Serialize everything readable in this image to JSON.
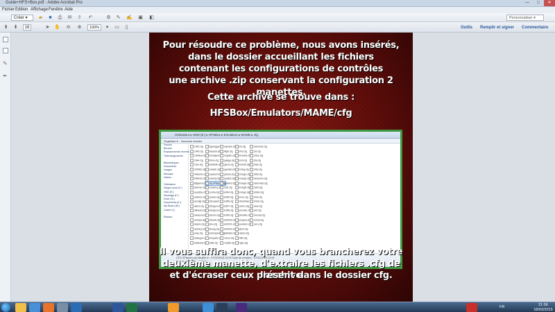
{
  "window": {
    "title": "Guide+HFS+Box.pdf - Adobe Acrobat Pro"
  },
  "menu": [
    "Fichier",
    "Edition",
    "Affichage",
    "Fenêtre",
    "Aide"
  ],
  "toolbar": {
    "create_label": "Créer",
    "personalize_label": "Personnaliser",
    "page_current": "16",
    "zoom": "100%",
    "links": [
      "Outils",
      "Remplir et signer",
      "Commentaire"
    ]
  },
  "document": {
    "paragraph1": [
      "Pour résoudre ce problème, nous avons insérés,",
      "dans le dossier accueillant les fichiers",
      "contenant les configurations de contrôles",
      "une archive .zip conservant la configuration 2 manettes."
    ],
    "paragraph2": "Cette archive se trouve dans :",
    "path": "HFSBox/Emulators/MAME/cfg",
    "paragraph3": [
      "Il vous suffira donc, quand vous brancherez votre",
      "deuxième manette, d'extraire les fichiers .cfg de l'archive",
      "et d'écraser ceux présent dans le dossier cfg."
    ]
  },
  "embedded_explorer": {
    "address": "Ordinateur ▸ HDD (E:) ▸ HFSBox ▸ Emulators ▸ MAME ▸ cfg",
    "nav": [
      "Favoris",
      "Bureau",
      "Emplacements récents",
      "Téléchargements",
      "",
      "Bibliothèques",
      "Documents",
      "Images",
      "Musique",
      "Vidéos",
      "",
      "Ordinateur",
      "Disque local (C:)",
      "HDD (E:)",
      "Stockage (F:)",
      "Drive (G:)",
      "Documents (K:)",
      "Mp Board (M:)",
      "Cache (I:)",
      "",
      "Réseau"
    ],
    "files": [
      "1942.cfg",
      "1943.cfg",
      "1943kai.cfg",
      "1944.cfg",
      "19xx.cfg",
      "2020bb.cfg",
      "4dwarrio.cfg",
      "64street.cfg",
      "88games.cfg",
      "aburner.cfg",
      "aceattac.cfg",
      "actfancr.cfg",
      "aerofgt.cfg",
      "aliens.cfg",
      "altbeast.cfg",
      "arkanoid.cfg",
      "armwar.cfg",
      "asterix.cfg",
      "atomicp.cfg",
      "avsp.cfg",
      "batsugun.cfg",
      "bbakraid.cfg",
      "bgaregga.cfg",
      "blazstar.cfg",
      "bombjack.cfg",
      "btime.cfg",
      "bublbobl.cfg",
      "cadash.cfg",
      "captcomm.cfg",
      "cawing.cfg",
      "cfg 2Players.zip",
      "chasehq.cfg",
      "contra.cfg",
      "cybots.cfg",
      "ddonpach.cfg",
      "ddragon.cfg",
      "ddragon2.cfg",
      "ddsom.cfg",
      "default.cfg",
      "dino.cfg",
      "dkong.cfg",
      "dodonpachi.cfg",
      "donpachi.cfg",
      "dstlk.cfg",
      "esprade.cfg",
      "ffight.cfg",
      "forgottn.cfg",
      "galaga.cfg",
      "garou.cfg",
      "gauntlet.cfg",
      "ghouls.cfg",
      "gradius.cfg",
      "gunbird.cfg",
      "hsf2.cfg",
      "kof94.cfg",
      "kof95.cfg",
      "kof96.cfg",
      "kof97.cfg",
      "kof98.cfg",
      "kof99.cfg",
      "kof2000.cfg",
      "kof2001.cfg",
      "kof2002.cfg",
      "lastblad.cfg",
      "mercs.cfg",
      "metalb.cfg",
      "mk.cfg",
      "mk2.cfg",
      "mmatrix.cfg",
      "msh.cfg",
      "mshvsf.cfg",
      "mslug.cfg",
      "mslug2.cfg",
      "mslug3.cfg",
      "mslug4.cfg",
      "mslug5.cfg",
      "mslugx.cfg",
      "mvsc.cfg",
      "nbbatman.cfg",
      "outrun.cfg",
      "pacman.cfg",
      "pbobble.cfg",
      "progear.cfg",
      "punisher.cfg",
      "qbert.cfg",
      "rastan.cfg",
      "rbff2.cfg",
      "rtype.cfg",
      "samsho2.cfg",
      "sf2.cfg",
      "sf2ce.cfg",
      "sfa.cfg",
      "sfa2.cfg",
      "sfa3.cfg",
      "sfiii3.cfg",
      "simpsons.cfg",
      "slammast.cfg",
      "ssf2t.cfg",
      "strider.cfg",
      "tmnt.cfg",
      "tmnt2.cfg",
      "vsav.cfg",
      "wof.cfg",
      "xmcota.cfg",
      "xmvsf.cfg",
      "zero.cfg"
    ],
    "status_lines": [
      "CFG 2Players.zip   Modifié le : 07/02/2015 12:09   Date de création : 07/02/2015 12:09",
      "Archive ZIP   Taille : 2,66 Ko"
    ]
  },
  "taskbar": {
    "time": "21:56",
    "date": "18/02/2015",
    "lang": "FR"
  },
  "colors": {
    "page_bg": "#5e0d0a",
    "green_frame": "#3f9a44",
    "link": "#2a5a9a"
  }
}
